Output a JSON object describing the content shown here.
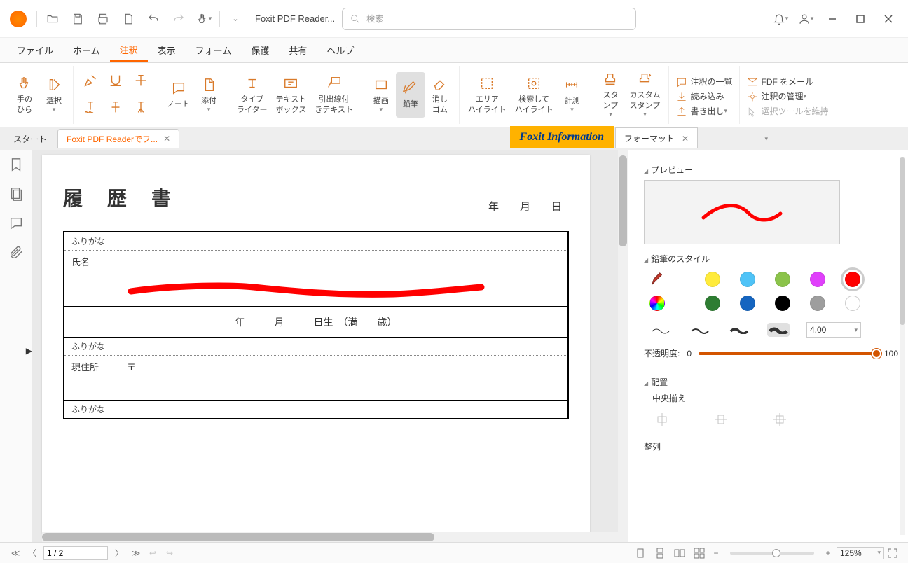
{
  "app": {
    "title": "Foxit PDF Reader..."
  },
  "search": {
    "placeholder": "検索"
  },
  "menu": {
    "items": [
      "ファイル",
      "ホーム",
      "注釈",
      "表示",
      "フォーム",
      "保護",
      "共有",
      "ヘルプ"
    ],
    "active_index": 2
  },
  "ribbon": {
    "hand": "手の\nひら",
    "select": "選択",
    "note": "ノート",
    "attach": "添付",
    "typewriter": "タイプ\nライター",
    "textbox": "テキスト\nボックス",
    "callout": "引出線付\nきテキスト",
    "draw": "描画",
    "pencil": "鉛筆",
    "eraser": "消し\nゴム",
    "area_hl": "エリア\nハイライト",
    "search_hl": "検索して\nハイライト",
    "measure": "計測",
    "stamp": "スタ\nンプ",
    "custom_stamp": "カスタム\nスタンプ",
    "list": "注釈の一覧",
    "fdfmail": "FDF をメール",
    "import": "読み込み",
    "manage": "注釈の管理",
    "export": "書き出し",
    "keepsel": "選択ツールを維持"
  },
  "tabs": {
    "start": "スタート",
    "doc": "Foxit PDF Readerでフ...",
    "info_banner": "Foxit Information",
    "format": "フォーマット"
  },
  "document": {
    "title": "履 歴 書",
    "dateline": "年　　月　　日",
    "furigana": "ふりがな",
    "name_label": "氏名",
    "birth_line": "年　　　月　　　日生　（満　　歳）",
    "address_label": "現住所",
    "postal_mark": "〒"
  },
  "format_panel": {
    "preview": "プレビュー",
    "pencil_style": "鉛筆のスタイル",
    "colors_row1": [
      "#ffeb3b",
      "#4fc3f7",
      "#8bc34a",
      "#e040fb",
      "#ff0000"
    ],
    "colors_row2": [
      "rainbow",
      "#2e7d32",
      "#1565c0",
      "#000000",
      "#9e9e9e",
      "#ffffff"
    ],
    "width_value": "4.00",
    "opacity_label": "不透明度:",
    "opacity_min": "0",
    "opacity_max": "100",
    "arrange": "配置",
    "center": "中央揃え",
    "align_section": "整列"
  },
  "status": {
    "page": "1 / 2",
    "zoom": "125%",
    "minus": "−",
    "plus": "+"
  }
}
